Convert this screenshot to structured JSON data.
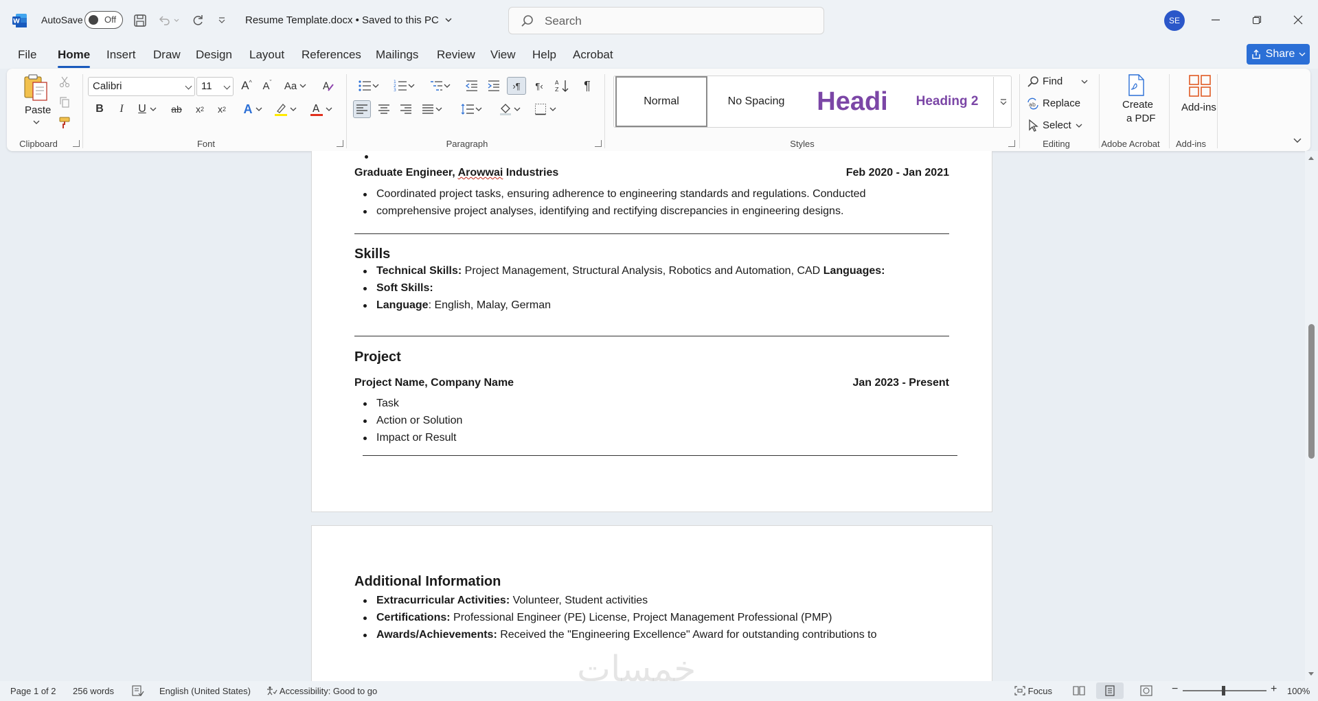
{
  "titlebar": {
    "autosave_label": "AutoSave",
    "autosave_state": "Off",
    "document_title": "Resume Template.docx • Saved to this PC",
    "search_placeholder": "Search",
    "user_initials": "SE"
  },
  "menu": {
    "tabs": [
      "File",
      "Home",
      "Insert",
      "Draw",
      "Design",
      "Layout",
      "References",
      "Mailings",
      "Review",
      "View",
      "Help",
      "Acrobat"
    ],
    "active_tab": "Home",
    "share_label": "Share"
  },
  "ribbon": {
    "clipboard": {
      "label": "Clipboard",
      "paste_label": "Paste"
    },
    "font": {
      "label": "Font",
      "font_name": "Calibri",
      "font_size": "11"
    },
    "paragraph": {
      "label": "Paragraph"
    },
    "styles": {
      "label": "Styles",
      "items": [
        "Normal",
        "No Spacing",
        "Headi",
        "Heading 2"
      ],
      "selected": "Normal",
      "heading_color": "#7b46a6"
    },
    "editing": {
      "label": "Editing",
      "find": "Find",
      "replace": "Replace",
      "select": "Select"
    },
    "acrobat": {
      "label": "Adobe Acrobat",
      "create_pdf_line1": "Create",
      "create_pdf_line2": "a PDF"
    },
    "addins": {
      "label": "Add-ins",
      "button": "Add-ins"
    }
  },
  "document": {
    "experience": {
      "role": "Graduate Engineer, ",
      "company": "Arowwai",
      "company_suffix": " Industries",
      "dates": "Feb 2020 - Jan 2021",
      "bullets": [
        "Coordinated project tasks, ensuring adherence to engineering standards and regulations. Conducted",
        "comprehensive project analyses, identifying and rectifying discrepancies in engineering designs."
      ]
    },
    "skills": {
      "heading": "Skills",
      "technical_label": "Technical Skills:",
      "technical_value": " Project Management, Structural Analysis, Robotics and Automation, CAD ",
      "technical_trailing": "Languages:",
      "soft_label": "Soft Skills:",
      "language_label": "Language",
      "language_value": ":  English, Malay, German"
    },
    "project": {
      "heading": "Project",
      "title": "Project Name, Company Name",
      "dates": "Jan 2023 - Present",
      "bullets": [
        "Task",
        "Action or Solution",
        "Impact or Result"
      ]
    },
    "additional": {
      "heading": "Additional Information",
      "extracurricular_label": "Extracurricular Activities:",
      "extracurricular_value": " Volunteer, Student activities",
      "certifications_label": "Certifications:",
      "certifications_value": " Professional Engineer (PE) License, Project Management Professional (PMP)",
      "awards_label": "Awards/Achievements:",
      "awards_value": " Received the \"Engineering Excellence\" Award for outstanding contributions to"
    }
  },
  "statusbar": {
    "page": "Page 1 of 2",
    "words": "256 words",
    "language": "English (United States)",
    "accessibility": "Accessibility: Good to go",
    "focus": "Focus",
    "zoom": "100%"
  },
  "watermark": "خمسات",
  "colors": {
    "accent": "#185abd",
    "share": "#2b6fd6",
    "avatar": "#2b57c9"
  }
}
